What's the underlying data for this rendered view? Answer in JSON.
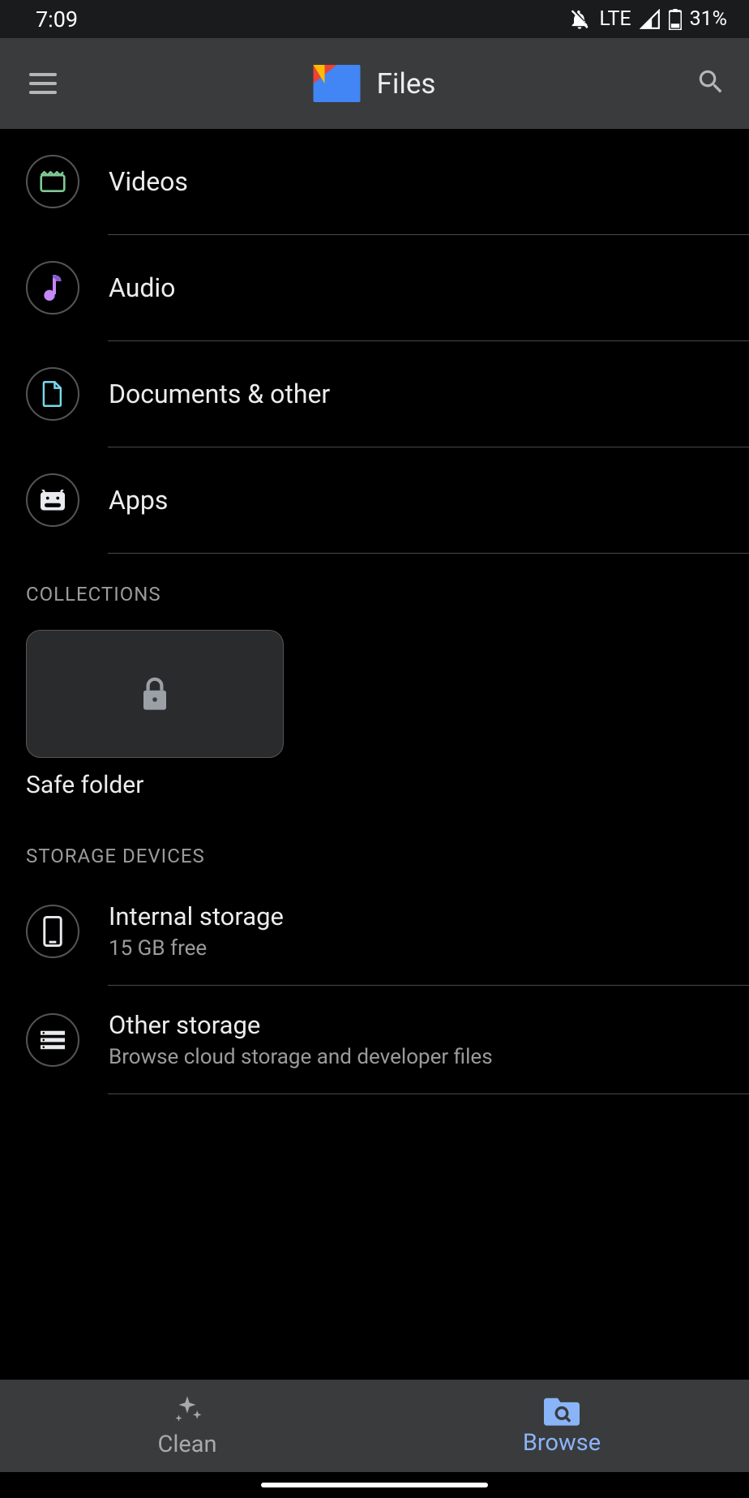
{
  "status": {
    "time": "7:09",
    "network": "LTE",
    "battery": "31%"
  },
  "header": {
    "title": "Files"
  },
  "categories": [
    {
      "id": "videos",
      "label": "Videos"
    },
    {
      "id": "audio",
      "label": "Audio"
    },
    {
      "id": "documents",
      "label": "Documents & other"
    },
    {
      "id": "apps",
      "label": "Apps"
    }
  ],
  "sections": {
    "collections": "COLLECTIONS",
    "storage": "STORAGE DEVICES"
  },
  "collections": {
    "safe_folder": "Safe folder"
  },
  "storage": [
    {
      "id": "internal",
      "title": "Internal storage",
      "sub": "15 GB free"
    },
    {
      "id": "other",
      "title": "Other storage",
      "sub": "Browse cloud storage and developer files"
    }
  ],
  "nav": {
    "clean": "Clean",
    "browse": "Browse"
  }
}
